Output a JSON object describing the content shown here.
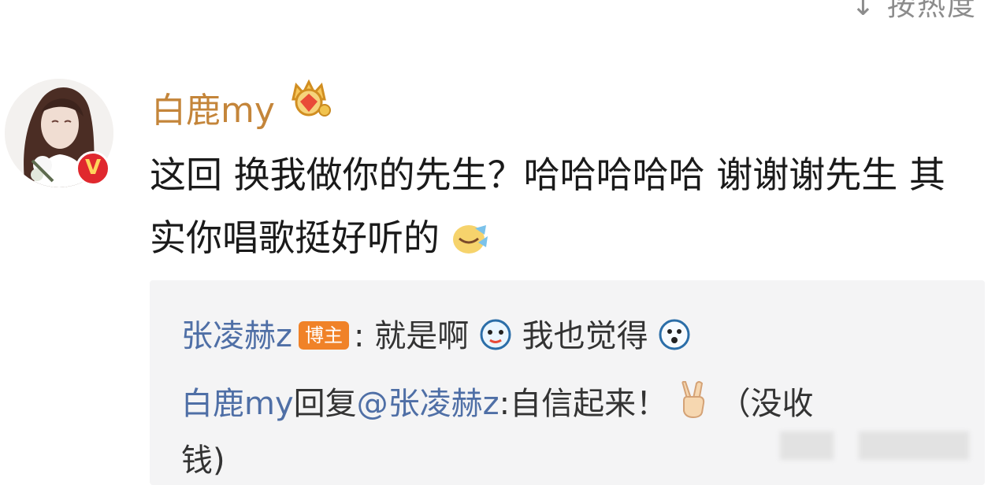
{
  "header": {
    "sort_label": "↓ 按热度"
  },
  "comment": {
    "author": "白鹿my",
    "text": "这回 换我做你的先生？哈哈哈哈哈 谢谢谢先生 其实你唱歌挺好听的",
    "verified_badge": "V",
    "emoji": "laughing-emoji"
  },
  "replies": [
    {
      "author": "张凌赫z",
      "tag": "博主",
      "separator": ":",
      "text_1": "就是啊",
      "text_2": "我也觉得"
    },
    {
      "author": "白鹿my",
      "reply_word": "回复",
      "mention": "@张凌赫z",
      "text_1": ":自信起来！",
      "text_2": "（没收",
      "text_3": "钱)"
    }
  ],
  "colors": {
    "username": "#c4853a",
    "reply_name": "#4f6fa6",
    "reply_background": "#f4f4f5",
    "tag_background": "#f08228",
    "verified_badge": "#e0282e"
  }
}
